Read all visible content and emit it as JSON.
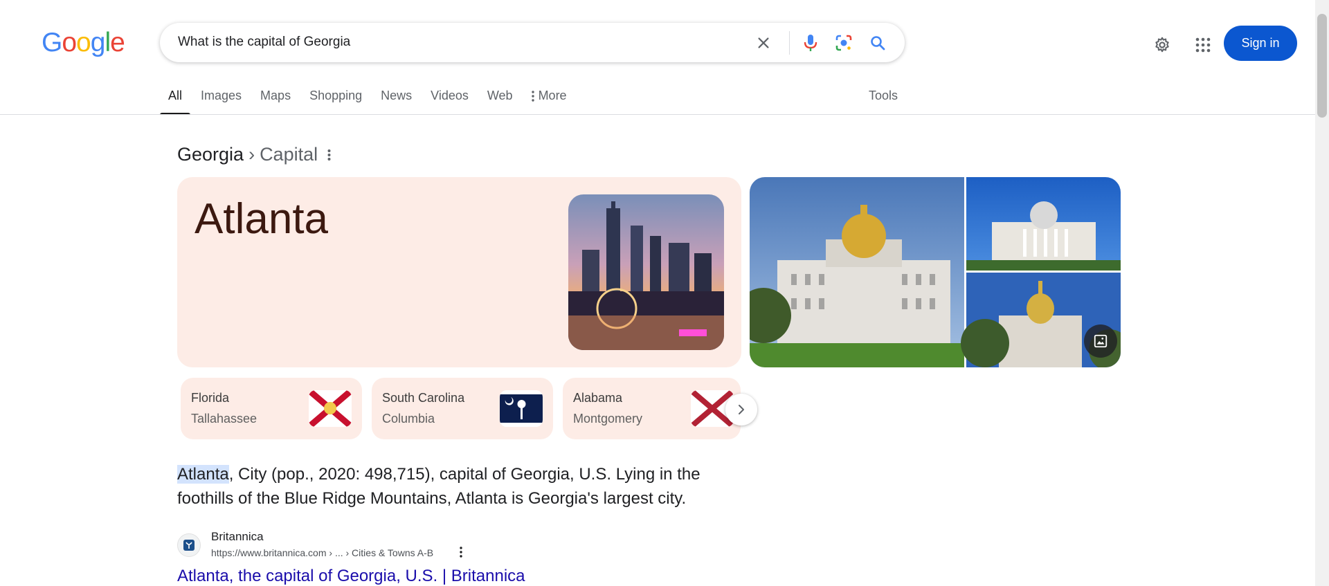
{
  "header": {
    "logo_text": "Google",
    "search_query": "What is the capital of Georgia",
    "sign_in_label": "Sign in"
  },
  "tabs": {
    "items": [
      "All",
      "Images",
      "Maps",
      "Shopping",
      "News",
      "Videos",
      "Web"
    ],
    "more_label": "More",
    "tools_label": "Tools",
    "active": "All"
  },
  "breadcrumb": {
    "entity": "Georgia",
    "separator": "›",
    "attribute": "Capital"
  },
  "answer": {
    "title": "Atlanta"
  },
  "related": [
    {
      "state": "Florida",
      "capital": "Tallahassee"
    },
    {
      "state": "South Carolina",
      "capital": "Columbia"
    },
    {
      "state": "Alabama",
      "capital": "Montgomery"
    }
  ],
  "snippet": {
    "highlight": "Atlanta",
    "text": ", City (pop., 2020: 498,715), capital of Georgia, U.S. Lying in the foothills of the Blue Ridge Mountains, Atlanta is Georgia's largest city."
  },
  "source": {
    "name": "Britannica",
    "url": "https://www.britannica.com › ... › Cities & Towns A-B",
    "title": "Atlanta, the capital of Georgia, U.S. | Britannica"
  },
  "colors": {
    "brand_blue": "#0b57d0",
    "card_bg": "#fdece6",
    "link": "#1a0dab"
  }
}
